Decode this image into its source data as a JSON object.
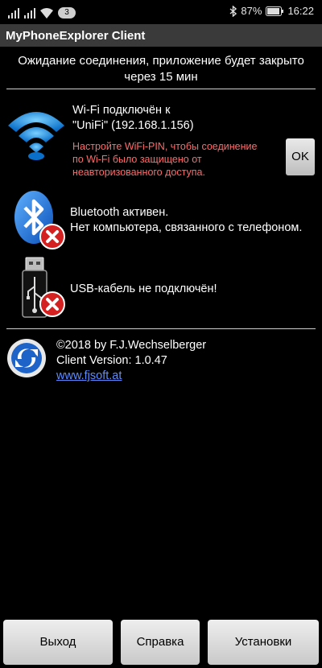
{
  "statusbar": {
    "notification_count": "3",
    "battery": "87%",
    "time": "16:22",
    "icons": [
      "signal-icon",
      "signal-icon",
      "wifi-icon",
      "bluetooth-icon",
      "vibrate-icon",
      "battery-icon"
    ]
  },
  "app": {
    "title": "MyPhoneExplorer Client"
  },
  "status_message": {
    "line1": "Ожидание соединения, приложение будет закрыто",
    "line2": "через 15 мин"
  },
  "wifi": {
    "line1": "Wi-Fi подключён к",
    "line2": "\"UniFi\" (192.168.1.156)",
    "warning_line1": "Настройте WiFi-PIN, чтобы соединение",
    "warning_line2": "по Wi-Fi было защищено от",
    "warning_line3": "неавторизованного доступа.",
    "ok_label": "OK"
  },
  "bluetooth": {
    "line1": "Bluetooth активен.",
    "line2": "Нет компьютера, связанного с телефоном."
  },
  "usb": {
    "line1": "USB-кабель не подключён!"
  },
  "about": {
    "copyright": "©2018 by F.J.Wechselberger",
    "version": "Client Version: 1.0.47",
    "link": "www.fjsoft.at"
  },
  "buttons": {
    "exit": "Выход",
    "help": "Справка",
    "settings": "Установки"
  },
  "colors": {
    "warning": "#ff6a6a",
    "link": "#5c8cff",
    "titlebar": "#3a3a3a",
    "error_badge": "#d32020",
    "wifi_blue": "#1e8fe0"
  }
}
